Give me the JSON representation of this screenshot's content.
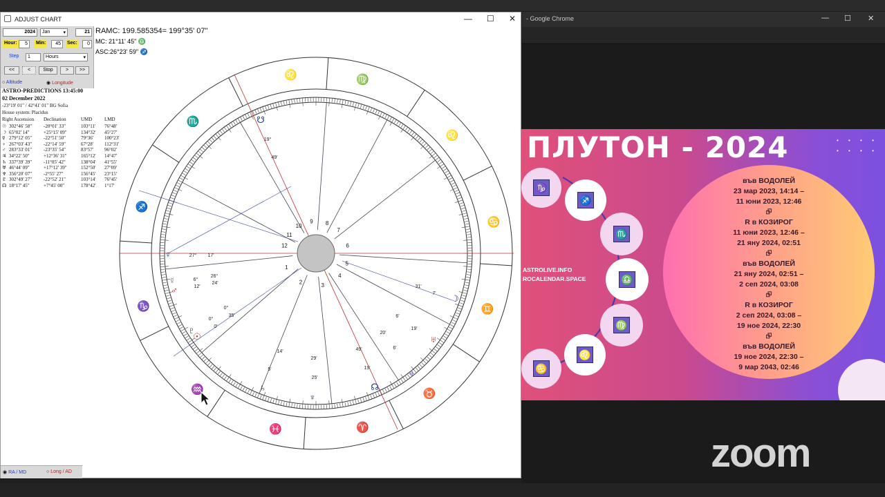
{
  "window": {
    "title": "ADJUST CHART",
    "minimize": "—",
    "maximize": "☐",
    "close": "✕"
  },
  "controls": {
    "year": "2024",
    "month": "Jan",
    "day": "21",
    "hour_label": "Hour:",
    "hour": "5",
    "min_label": "Min:",
    "min": "45",
    "sec_label": "Sec:",
    "sec": "0",
    "step_label": "Step",
    "step": "1",
    "step_unit": "Hours",
    "btn_back2": "<<",
    "btn_back": "<",
    "btn_stop": "Stop",
    "btn_fwd": ">",
    "btn_fwd2": ">>",
    "radio_altitude": "Altitude",
    "radio_longitude": "Longitude",
    "radio_ramd": "RA / MD",
    "radio_longad": "Long / AD"
  },
  "readouts": {
    "ramc": "RAMC: 199.585354= 199°35' 07\"",
    "mc": "MC: 21°11' 45\"",
    "asc": "ASC:26°23' 59\""
  },
  "info": {
    "title": "ASTRO-PREDICTIONS 13:45:00",
    "date": "02 December 2022",
    "location": "-23°19' 01\" / 42°41' 01\"  BG Sofia",
    "house_system": "House system: Placidus",
    "headers": [
      "Right Ascension",
      "Declination",
      "UMD",
      "LMD"
    ],
    "rows": [
      [
        "☉",
        "302°46' 58\"",
        "-20°01' 33\"",
        "103°11'",
        "76°48'"
      ],
      [
        "☽",
        "65°02' 14\"",
        "+25°15' 09\"",
        "134°32'",
        "45°27'"
      ],
      [
        "☿",
        "279°12' 05\"",
        "-22°51' 50\"",
        "79°36'",
        "100°23'"
      ],
      [
        "♀",
        "267°03' 43\"",
        "-22°14' 59\"",
        "67°28'",
        "112°31'"
      ],
      [
        "♂",
        "283°33' 01\"",
        "-23°35' 54\"",
        "83°57'",
        "96°02'"
      ],
      [
        "♃",
        "34°22' 50\"",
        "+12°36' 31\"",
        "165°12'",
        "14°47'"
      ],
      [
        "♄",
        "337°39' 39\"",
        "-11°05' 42\"",
        "138°04'",
        "41°55'"
      ],
      [
        "♅",
        "46°44' 09\"",
        "+17°12' 39\"",
        "152°50'",
        "27°09'"
      ],
      [
        "♆",
        "356°20' 07\"",
        "-2°55' 27\"",
        "156°45'",
        "23°15'"
      ],
      [
        "♇",
        "302°49' 27\"",
        "-22°52' 21\"",
        "103°14'",
        "76°45'"
      ],
      [
        "☊",
        "18°17' 45\"",
        "+7°45' 00\"",
        "178°42'",
        "1°17'"
      ]
    ]
  },
  "wheel": {
    "signs": [
      "♌",
      "♍",
      "♌",
      "♋",
      "♊",
      "♉",
      "♈",
      "♓",
      "♒",
      "♑",
      "♐",
      "♏"
    ],
    "house_numbers": [
      "9",
      "8",
      "7",
      "6",
      "5",
      "4",
      "3",
      "2",
      "1",
      "12",
      "11",
      "10"
    ],
    "planets": [
      {
        "glyph": "☋",
        "color": "#1a3a8a",
        "deg": "19°",
        "min": "49'"
      },
      {
        "glyph": "♀",
        "color": "#1a3a8a",
        "deg": "27°",
        "min": "17'"
      },
      {
        "glyph": "☿",
        "color": "#777",
        "deg": "6°",
        "min": "12'"
      },
      {
        "glyph": "♂",
        "color": "#c02020",
        "deg": "26°",
        "min": "24'"
      },
      {
        "glyph": "♇",
        "color": "#1a1a1a",
        "deg": "0°",
        "min": "35'"
      },
      {
        "glyph": "☉",
        "color": "#c02020",
        "deg": "0°",
        "min": "0'"
      },
      {
        "glyph": "♄",
        "color": "#1a1a1a",
        "deg": "14'",
        "min": "5'"
      },
      {
        "glyph": "♆",
        "color": "#1a3a8a",
        "deg": "29'",
        "min": "25'"
      },
      {
        "glyph": "☊",
        "color": "#1a3a8a",
        "deg": "49'",
        "min": "19'"
      },
      {
        "glyph": "♃",
        "color": "#3a3a9a",
        "deg": "20'",
        "min": "6'"
      },
      {
        "glyph": "♅",
        "color": "#c02020",
        "deg": "6'",
        "min": "19'"
      },
      {
        "glyph": "☽",
        "color": "#1a1a6a",
        "deg": "31'",
        "min": "7'"
      }
    ]
  },
  "slide": {
    "title": "ПЛУТОН - 2024",
    "lines": [
      "във ВОДОЛЕЙ",
      "23 мар 2023, 14:14 –",
      "11 юни 2023, 12:46",
      "⮺",
      "R в КОЗИРОГ",
      "11 юни 2023, 12:46 –",
      "21 яну 2024, 02:51",
      "⮺",
      "във ВОДОЛЕЙ",
      "21 яну 2024, 02:51 –",
      "2 сеп 2024, 03:08",
      "⮺",
      "R в КОЗИРОГ",
      "2 сеп 2024, 03:08 –",
      "19 ное 2024, 22:30",
      "⮺",
      "във ВОДОЛЕЙ",
      "19 ное 2024, 22:30 –",
      "9 мар 2043, 02:46"
    ],
    "link1": "ASTROLIVE.INFO",
    "link2": "ROCALENDAR.SPACE",
    "zodiac_icons": [
      "♑",
      "♐",
      "♏",
      "♎",
      "♍",
      "♌",
      "♋"
    ]
  },
  "chrome": {
    "title": "- Google Chrome"
  },
  "zoom": {
    "logo": "zoom"
  }
}
